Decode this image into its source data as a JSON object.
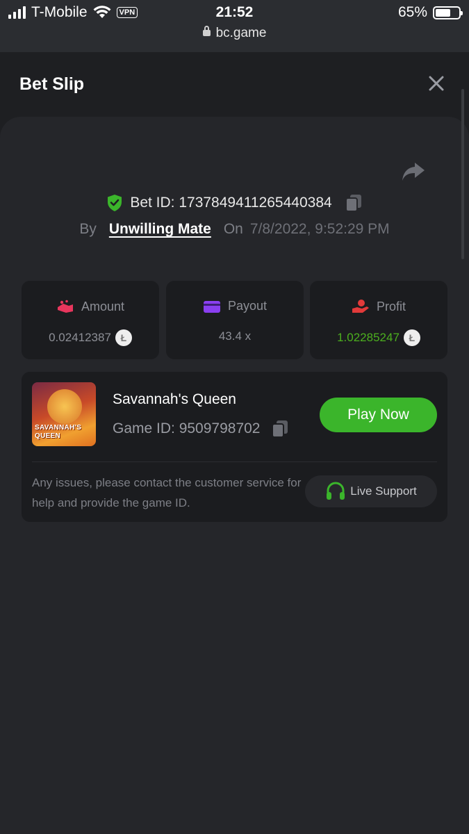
{
  "status_bar": {
    "carrier": "T-Mobile",
    "vpn": "VPN",
    "time": "21:52",
    "url": "bc.game",
    "battery": "65%",
    "battery_level": 0.65
  },
  "header": {
    "title": "Bet Slip",
    "close_icon": "close-icon"
  },
  "bet": {
    "id_label": "Bet ID: 1737849411265440384",
    "by_label": "By",
    "user": "Unwilling Mate",
    "on_label": "On",
    "date": "7/8/2022, 9:52:29 PM"
  },
  "stats": [
    {
      "label": "Amount",
      "value": "0.02412387",
      "icon": "amount-icon",
      "color": "#e8365d"
    },
    {
      "label": "Payout",
      "value": "43.4 x",
      "icon": "payout-icon",
      "color": "#8a3ff0"
    },
    {
      "label": "Profit",
      "value": "1.02285247",
      "icon": "profit-icon",
      "color": "#e23a3a"
    }
  ],
  "coin_symbol": "Ł",
  "game": {
    "name": "Savannah's Queen",
    "id_label": "Game ID: 9509798702",
    "thumb_text": "SAVANNAH'S\nQUEEN",
    "play_label": "Play Now",
    "issue_text": "Any issues, please contact the customer service for help and provide the game ID.",
    "support_label": "Live Support"
  },
  "colors": {
    "accent_green": "#3bb52b",
    "profit_green": "#4caf1e",
    "background": "#1e1f22",
    "panel": "#25262a",
    "card": "#1b1c1f"
  }
}
